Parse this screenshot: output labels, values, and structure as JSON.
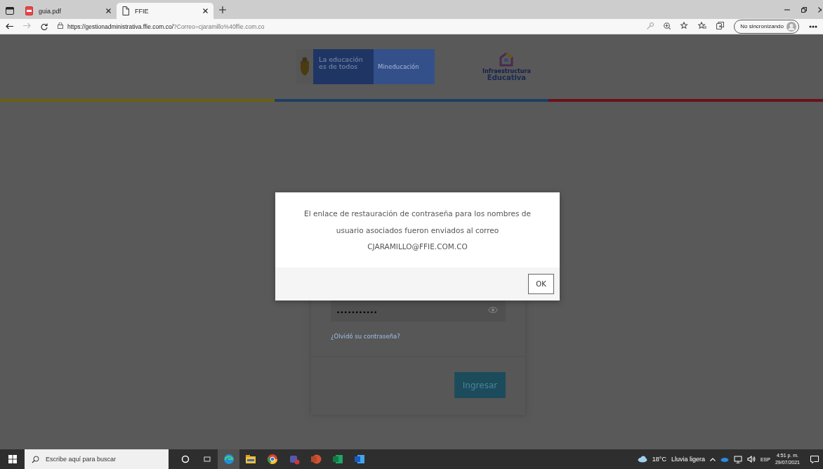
{
  "browser": {
    "tabs": [
      {
        "title": "guia.pdf",
        "kind": "pdf",
        "selected": false
      },
      {
        "title": "FFIE",
        "kind": "page",
        "selected": true
      }
    ],
    "url_host": "https://gestionadministrativa.ffie.com.co/",
    "url_rest": "?Correo=cjaramillo%40ffie.com.co",
    "profile_label": "No sincronizando"
  },
  "header": {
    "slogan": "La educación es de todos",
    "ministry": "Mineducación",
    "logo_small": "Infraestructura",
    "logo_big": "Educativa"
  },
  "login": {
    "password_value": "•••••••••••",
    "forgot_link": "¿Olvidó su contraseña?",
    "submit": "Ingresar"
  },
  "dialog": {
    "message": "El enlace de restauración de contraseña para los nombres de usuario asociados fueron enviados al correo",
    "email": "CJARAMILLO@FFIE.COM.CO",
    "ok": "OK"
  },
  "taskbar": {
    "search_placeholder": "Escribe aquí para buscar",
    "apps": [
      {
        "kind": "cortana",
        "active": false
      },
      {
        "kind": "taskview",
        "active": false
      },
      {
        "kind": "edge",
        "active": true
      },
      {
        "kind": "explorer",
        "active": false
      },
      {
        "kind": "chrome",
        "active": false
      },
      {
        "kind": "teams",
        "active": false
      },
      {
        "kind": "powerpoint",
        "active": false
      },
      {
        "kind": "excel",
        "active": false
      },
      {
        "kind": "word",
        "active": false
      }
    ],
    "weather": "18°C",
    "weather_text": "Lluvia ligera",
    "language": "ESP",
    "time": "4:51 p. m.",
    "date": "29/07/2021"
  }
}
